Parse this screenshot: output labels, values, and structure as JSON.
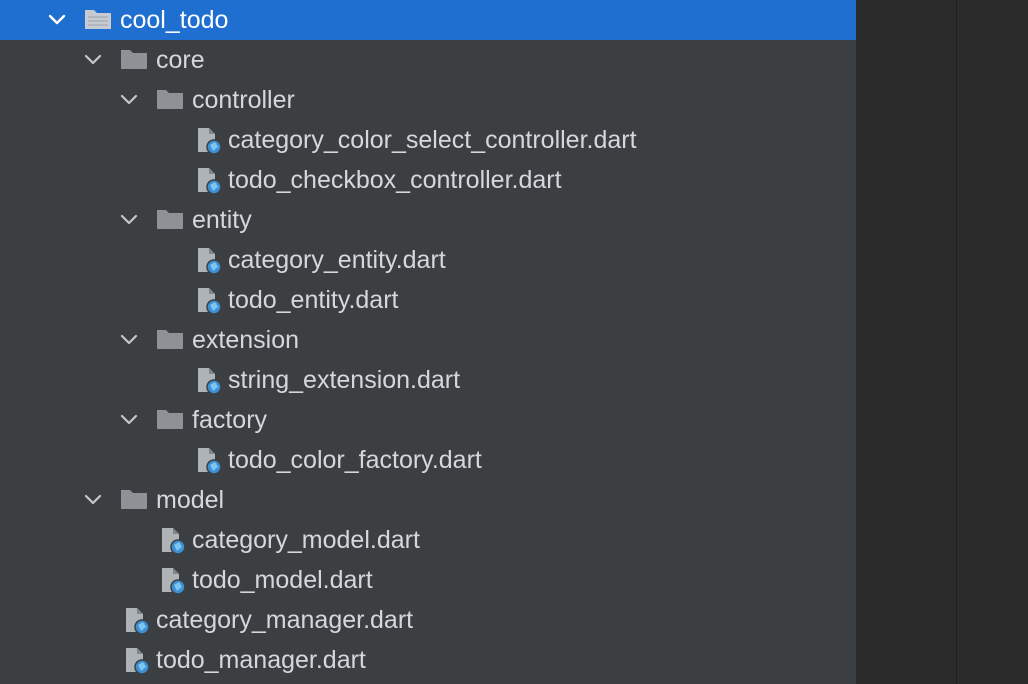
{
  "project_tree": {
    "root": {
      "label": "cool_todo",
      "icon": "folder-icon",
      "expanded": true,
      "selected": true
    },
    "core": {
      "label": "core",
      "icon": "folder-icon",
      "expanded": true
    },
    "controller": {
      "label": "controller",
      "icon": "folder-icon",
      "expanded": true
    },
    "category_color_select_controller": {
      "label": "category_color_select_controller.dart",
      "icon": "dart-file-icon"
    },
    "todo_checkbox_controller": {
      "label": "todo_checkbox_controller.dart",
      "icon": "dart-file-icon"
    },
    "entity": {
      "label": "entity",
      "icon": "folder-icon",
      "expanded": true
    },
    "category_entity": {
      "label": "category_entity.dart",
      "icon": "dart-file-icon"
    },
    "todo_entity": {
      "label": "todo_entity.dart",
      "icon": "dart-file-icon"
    },
    "extension": {
      "label": "extension",
      "icon": "folder-icon",
      "expanded": true
    },
    "string_extension": {
      "label": "string_extension.dart",
      "icon": "dart-file-icon"
    },
    "factory": {
      "label": "factory",
      "icon": "folder-icon",
      "expanded": true
    },
    "todo_color_factory": {
      "label": "todo_color_factory.dart",
      "icon": "dart-file-icon"
    },
    "model": {
      "label": "model",
      "icon": "folder-icon",
      "expanded": true
    },
    "category_model": {
      "label": "category_model.dart",
      "icon": "dart-file-icon"
    },
    "todo_model": {
      "label": "todo_model.dart",
      "icon": "dart-file-icon"
    },
    "category_manager": {
      "label": "category_manager.dart",
      "icon": "dart-file-icon"
    },
    "todo_manager": {
      "label": "todo_manager.dart",
      "icon": "dart-file-icon"
    }
  },
  "colors": {
    "panel_background": "#3c3f41",
    "selection": "#1f6fd0",
    "text": "#d4d8dd",
    "folder": "#8e9297",
    "dart_badge": "#3d8fd6",
    "editor_background": "#2b2b2b"
  }
}
